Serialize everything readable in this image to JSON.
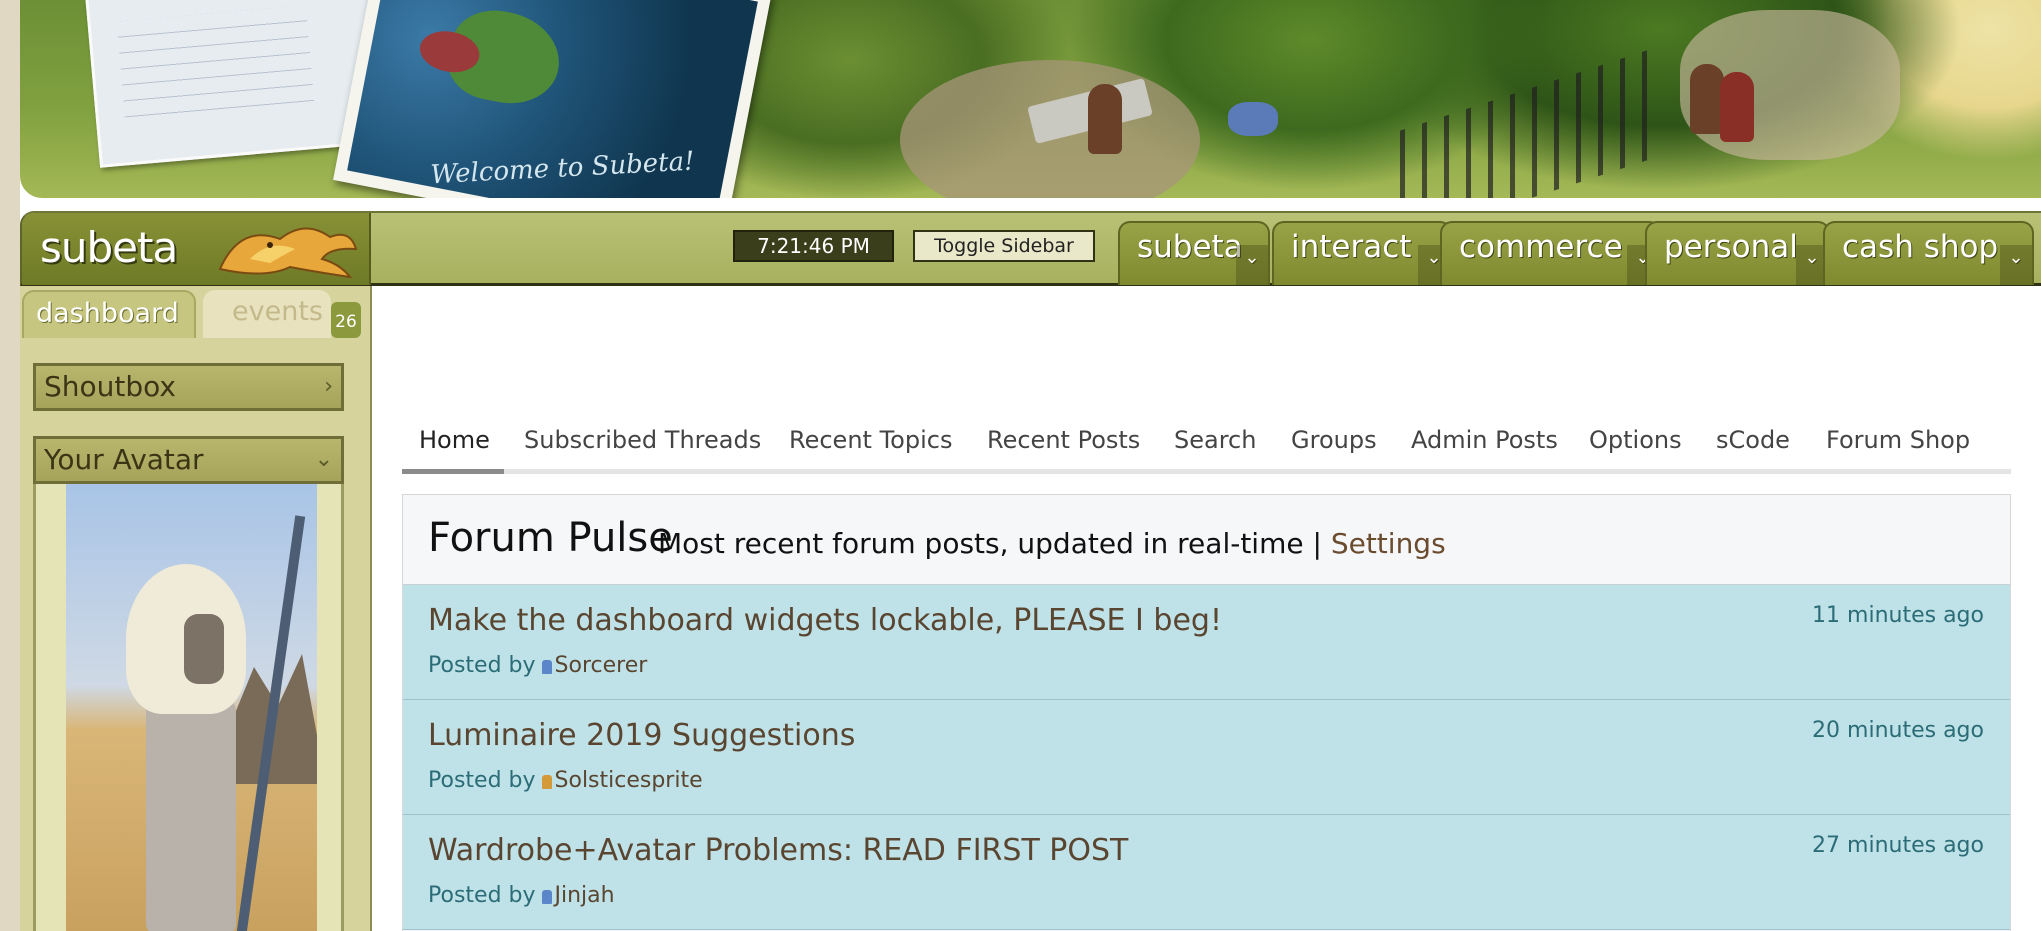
{
  "header": {
    "logo_text": "subeta",
    "postcard_text": "Welcome to Subeta!",
    "clock": "7:21:46 PM",
    "toggle_sidebar": "Toggle Sidebar",
    "menus": [
      {
        "label": "subeta"
      },
      {
        "label": "interact"
      },
      {
        "label": "commerce"
      },
      {
        "label": "personal"
      },
      {
        "label": "cash shop"
      }
    ]
  },
  "sidebar": {
    "tabs": {
      "dashboard": "dashboard",
      "events": "events",
      "events_count": "26"
    },
    "panels": {
      "shoutbox": "Shoutbox",
      "your_avatar": "Your Avatar"
    }
  },
  "forum": {
    "tabs": [
      "Home",
      "Subscribed Threads",
      "Recent Topics",
      "Recent Posts",
      "Search",
      "Groups",
      "Admin Posts",
      "Options",
      "sCode",
      "Forum Shop"
    ],
    "pulse": {
      "title": "Forum Pulse",
      "subtitle": "Most recent forum posts, updated in real-time | ",
      "settings": "Settings"
    },
    "posts": [
      {
        "title": "Make the dashboard widgets lockable, PLEASE I beg!",
        "posted_by": "Posted by",
        "user": "Sorcerer",
        "time": "11 minutes ago",
        "icon_color": "#5b86c9"
      },
      {
        "title": "Luminaire 2019 Suggestions",
        "posted_by": "Posted by",
        "user": "Solsticesprite",
        "time": "20 minutes ago",
        "icon_color": "#d49a3a"
      },
      {
        "title": "Wardrobe+Avatar Problems: READ FIRST POST",
        "posted_by": "Posted by",
        "user": "Jinjah",
        "time": "27 minutes ago",
        "icon_color": "#5b86c9"
      }
    ]
  },
  "colors": {
    "nav_bar": "#a7b15e",
    "sidebar_bg": "#d6d39d",
    "post_bg": "#bfe2e8",
    "post_title": "#5a4530",
    "post_meta": "#2b6c77"
  }
}
